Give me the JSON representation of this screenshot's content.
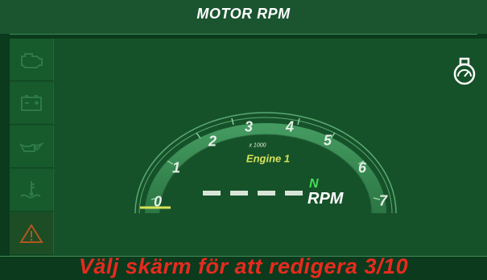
{
  "header": {
    "title": "MOTOR RPM"
  },
  "sidebar": {
    "items": [
      {
        "icon": "engine-icon",
        "active": false
      },
      {
        "icon": "battery-icon",
        "active": false
      },
      {
        "icon": "oil-can-icon",
        "active": false
      },
      {
        "icon": "coolant-temperature-icon",
        "active": false
      },
      {
        "icon": "warning-icon",
        "active": true
      }
    ]
  },
  "status": {
    "icon": "engine-status-icon"
  },
  "gauge": {
    "ticks": [
      "0",
      "1",
      "2",
      "3",
      "4",
      "5",
      "6",
      "7"
    ],
    "scale_label": "x 1000",
    "engine_label": "Engine 1",
    "gear": "N",
    "unit": "RPM",
    "value_display": "- - - -"
  },
  "footer": {
    "message": "Välj skärm för att redigera 3/10"
  },
  "colors": {
    "background": "#0b3a1d",
    "panel": "#165229",
    "gauge_band": "#3a8f55",
    "accent_yellow": "#d7e35a",
    "gear_green": "#44dd55",
    "footer_red": "#e82a1e",
    "warning_orange": "#b2561f"
  }
}
